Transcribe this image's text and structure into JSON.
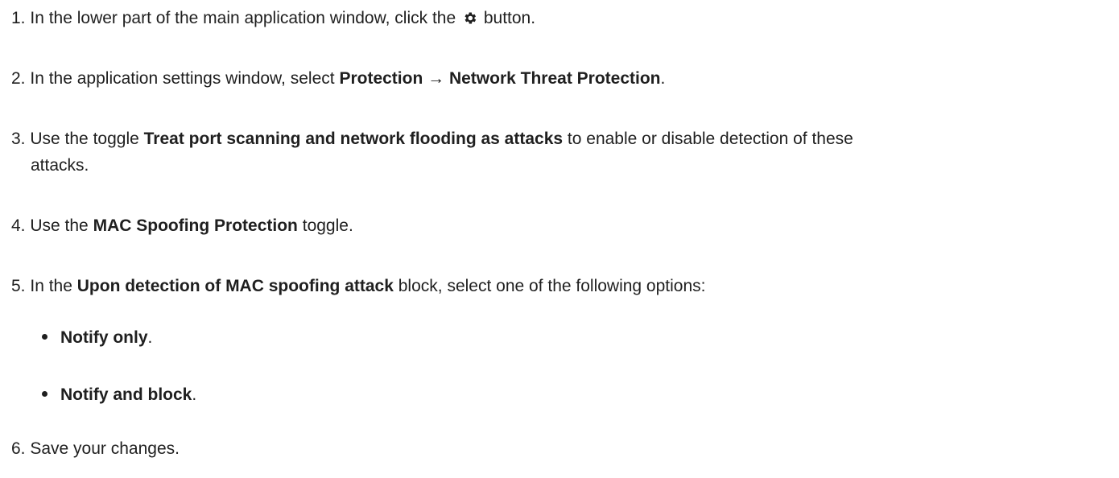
{
  "steps": [
    {
      "num": "1.",
      "pre": "In the lower part of the main application window, click the",
      "icon": "gear-icon",
      "post": "button."
    },
    {
      "num": "2.",
      "pre": "In the application settings window, select",
      "bold": "Protection → Network Threat Protection",
      "post": "."
    },
    {
      "num": "3.",
      "pre": "Use the toggle",
      "bold": "Treat port scanning and network flooding as attacks",
      "post": "to enable or disable detection of these",
      "post2": "attacks."
    },
    {
      "num": "4.",
      "pre": "Use the",
      "bold": "MAC Spoofing Protection",
      "post": "toggle."
    },
    {
      "num": "5.",
      "pre": "In the",
      "bold": "Upon detection of MAC spoofing attack",
      "post": "block, select one of the following options:"
    },
    {
      "num": "6.",
      "text": "Save your changes."
    }
  ],
  "options": [
    {
      "bold": "Notify only",
      "post": "."
    },
    {
      "bold": "Notify and block",
      "post": "."
    }
  ]
}
